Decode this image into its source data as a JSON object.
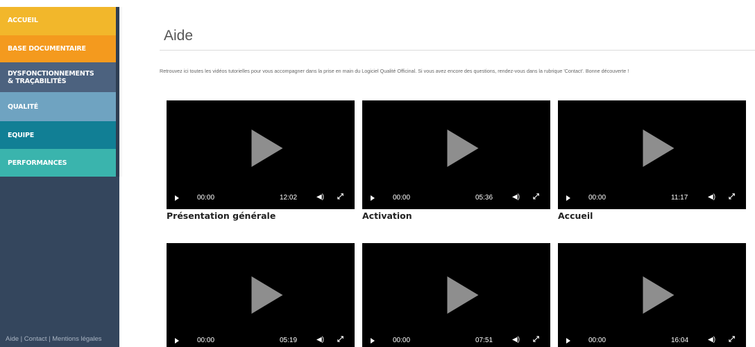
{
  "sidebar": {
    "items": [
      {
        "label": "ACCUEIL"
      },
      {
        "label": "BASE DOCUMENTAIRE"
      },
      {
        "label": "DYSFONCTIONNEMENTS"
      },
      {
        "label": "& TRAÇABILITÉS"
      },
      {
        "label": "QUALITÉ"
      },
      {
        "label": "EQUIPE"
      },
      {
        "label": "PERFORMANCES"
      }
    ],
    "colors": {
      "accueil": "#f2b72b",
      "base_documentaire": "#f49a1e",
      "dysfonctionnements": "#4c627f",
      "qualite": "#6fa3c1",
      "equipe": "#117f95",
      "performances": "#3ab4ad",
      "background": "#34465d"
    },
    "footer": {
      "aide": "Aide",
      "contact": "Contact",
      "mentions": "Mentions légales",
      "separator": "|"
    }
  },
  "main": {
    "title": "Aide",
    "intro": "Retrouvez ici toutes les vidéos tutorielles pour vous accompagner dans la prise en main du Logiciel Qualité Officinal. Si vous avez encore des questions, rendez-vous dans la rubrique 'Contact'. Bonne découverte !",
    "videos": [
      {
        "title": "Présentation générale",
        "current": "00:00",
        "duration": "12:02",
        "icons": [
          "play-icon",
          "volume-icon",
          "fullscreen-icon"
        ]
      },
      {
        "title": "Activation",
        "current": "00:00",
        "duration": "05:36"
      },
      {
        "title": "Accueil",
        "current": "00:00",
        "duration": "11:17"
      },
      {
        "title": "",
        "current": "00:00",
        "duration": "05:19"
      },
      {
        "title": "",
        "current": "00:00",
        "duration": "07:51"
      },
      {
        "title": "",
        "current": "00:00",
        "duration": "16:04"
      }
    ]
  }
}
